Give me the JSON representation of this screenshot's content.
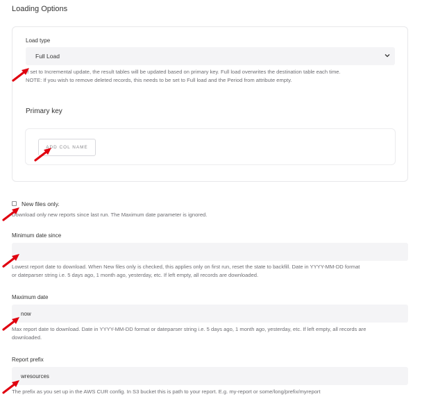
{
  "section_title": "Loading Options",
  "load_type": {
    "label": "Load type",
    "selected": "Full Load",
    "help_line1": "If set to Incremental update, the result tables will be updated based on primary key. Full load overwrites the destination table each time.",
    "help_line2": "NOTE: If you wish to remove deleted records, this needs to be set to Full load and the Period from attribute empty."
  },
  "primary_key": {
    "heading": "Primary key",
    "add_button": "ADD COL NAME"
  },
  "new_files_only": {
    "label": "New files only.",
    "help": "Download only new reports since last run. The Maximum date parameter is ignored.",
    "checked": false
  },
  "minimum_date": {
    "label": "Minimum date since",
    "value": "",
    "help_line1": "Lowest report date to download. When New files only is checked, this applies only on first run, reset the state to backfill. Date in YYYY-MM-DD format",
    "help_line2": "or dateparser string i.e. 5 days ago, 1 month ago, yesterday, etc. If left empty, all records are downloaded."
  },
  "maximum_date": {
    "label": "Maximum date",
    "value": "now",
    "help_line1": "Max report date to download. Date in YYYY-MM-DD format or dateparser string i.e. 5 days ago, 1 month ago, yesterday, etc. If left empty, all records are",
    "help_line2": "downloaded."
  },
  "report_prefix": {
    "label": "Report prefix",
    "value": "wresources",
    "help": "The prefix as you set up in the AWS CUR config. In S3 bucket this is path to your report. E.g. my-report or some/long/prefix/myreport"
  },
  "colors": {
    "annotation_arrow": "#e0000f",
    "field_background": "#f4f4f6",
    "help_text": "#6d6d72"
  }
}
